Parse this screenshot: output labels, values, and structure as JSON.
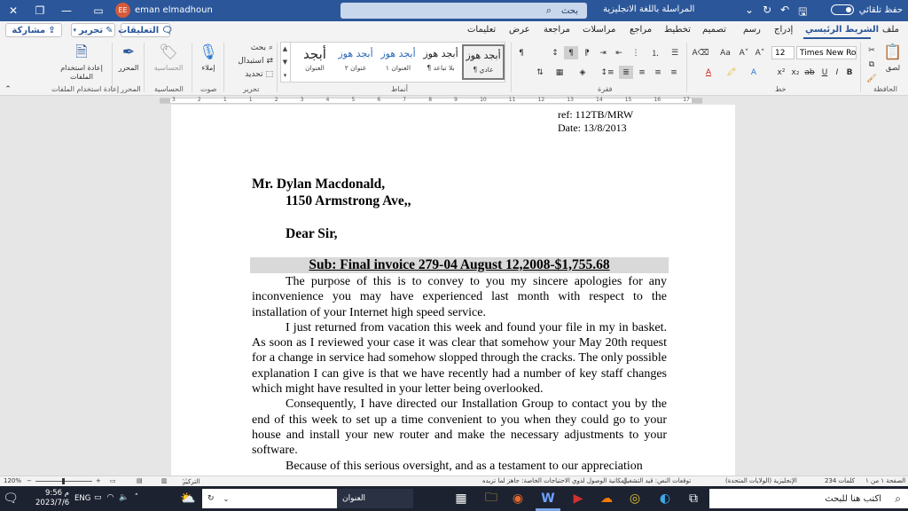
{
  "titlebar": {
    "autosave_label": "حفظ تلقائي",
    "document_title": "المراسلة باللغة الانجليزية",
    "search_placeholder": "بحث",
    "user_name": "eman elmadhoun",
    "user_initials": "EE"
  },
  "tabs": [
    {
      "label": "ملف"
    },
    {
      "label": "الشريط الرئيسي",
      "active": true
    },
    {
      "label": "إدراج"
    },
    {
      "label": "رسم"
    },
    {
      "label": "تصميم"
    },
    {
      "label": "تخطيط"
    },
    {
      "label": "مراجع"
    },
    {
      "label": "مراسلات"
    },
    {
      "label": "مراجعة"
    },
    {
      "label": "عرض"
    },
    {
      "label": "تعليمات"
    }
  ],
  "tab_actions": {
    "comments": "التعليقات",
    "edit": "تحرير",
    "share": "مشاركة"
  },
  "ribbon": {
    "groups": {
      "clipboard": "الحافظة",
      "font": "خط",
      "paragraph": "فقرة",
      "styles": "أنماط",
      "editing": "تحرير",
      "voice": "صوت",
      "sensitivity": "الحساسية",
      "editor": "المحرر",
      "reuse": "إعادة استخدام الملفات"
    },
    "paste_label": "لصق",
    "font_name": "Times New Roman",
    "font_size": "12",
    "styles": [
      {
        "preview": "أبجد هوز",
        "name": "¶ عادي"
      },
      {
        "preview": "أبجد هوز",
        "name": "¶ بلا تباعد"
      },
      {
        "preview": "أبجد هوز",
        "name": "العنوان ١"
      },
      {
        "preview": "أبجد هوز",
        "name": "عنوان ٢"
      },
      {
        "preview": "أبجد",
        "name": "العنوان"
      }
    ],
    "editing": {
      "find": "بحث",
      "replace": "استبدال",
      "select": "تحديد"
    },
    "dictate": "إملاء",
    "sensitivity": "الحساسية",
    "editor": "المحرر",
    "reuse_files": "إعادة استخدام الملفات"
  },
  "ruler_numbers": [
    "3",
    "2",
    "1",
    "1",
    "2",
    "3",
    "4",
    "5",
    "6",
    "7",
    "8",
    "9",
    "10",
    "11",
    "12",
    "13",
    "14",
    "15",
    "16",
    "17"
  ],
  "document": {
    "ref_line": "ref:  112TB/MRW",
    "date_line": "Date: 13/8/2013",
    "recipient_name": "Mr. Dylan Macdonald,",
    "recipient_address": "1150 Armstrong Ave,,",
    "salutation": "Dear Sir,",
    "subject": "Sub: Final invoice 279-04 August 12,2008-$1,755.68",
    "para1": "The purpose of this is to convey to you my sincere apologies for any inconvenience you may have experienced last month with respect to the installation of your Internet high speed service.",
    "para2": "I just returned from vacation this week and found your file in my in basket.  As soon as I reviewed your case it was clear that somehow your May 20th request for a change in service had somehow slopped through the cracks. The only possible explanation I can give is that we have recently had a number of key staff changes which might have resulted in your letter being overlooked.",
    "para3": "Consequently, I have directed our Installation Group to contact you by the end of this week to set up a time convenient to you when they could go to your house and install your new router and make the necessary adjustments to your software.",
    "para4": "Because of this serious oversight, and as a testament to our appreciation"
  },
  "statusbar": {
    "page": "الصفحة ١ من ١",
    "words": "234 كلمات",
    "language": "الإنجليزية (الولايات المتحدة)",
    "predictions": "توقعات النص: قيد التشغيل",
    "accessibility": "إمكانية الوصول لذوي الاحتياجات الخاصة: جاهز لما تريده",
    "focus": "التركيز",
    "zoom": "120%"
  },
  "taskbar": {
    "search_placeholder": "اكتب هنا للبحث",
    "time": "9:56 م",
    "date": "2023/7/6",
    "language": "ENG",
    "address_label": "العنوان"
  }
}
